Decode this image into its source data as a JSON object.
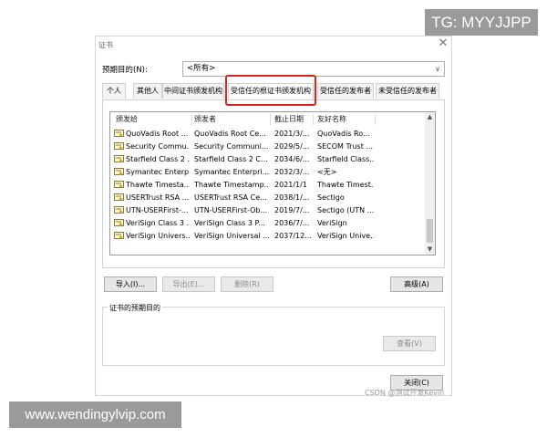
{
  "watermarks": {
    "top_right": "TG: MYYJJPP",
    "bottom_left": "www.wendingylvip.com",
    "csdn": "CSDN @测试开发Kevin"
  },
  "dialog": {
    "title": "证书",
    "close_glyph": "✕",
    "purpose_label": "预期目的(N):",
    "purpose_value": "<所有>",
    "tabs": [
      {
        "label": "个人"
      },
      {
        "label": "其他人"
      },
      {
        "label": "中间证书颁发机构"
      },
      {
        "label": "受信任的根证书颁发机构"
      },
      {
        "label": "受信任的发布者"
      },
      {
        "label": "未受信任的发布者"
      }
    ],
    "active_tab": 3,
    "columns": [
      "颁发给",
      "颁发者",
      "截止日期",
      "友好名称"
    ],
    "rows": [
      [
        "QuoVadis Root ...",
        "QuoVadis Root Ce...",
        "2021/3/...",
        "QuoVadis Ro..."
      ],
      [
        "Security Commu...",
        "Security Communi...",
        "2029/5/...",
        "SECOM Trust ..."
      ],
      [
        "Starfield Class 2 ...",
        "Starfield Class 2 C...",
        "2034/6/...",
        "Starfield Class..."
      ],
      [
        "Symantec Enterp...",
        "Symantec Enterpri...",
        "2032/3/...",
        "<无>"
      ],
      [
        "Thawte Timesta...",
        "Thawte Timestamp...",
        "2021/1/1",
        "Thawte Timest..."
      ],
      [
        "USERTrust RSA ...",
        "USERTrust RSA Ce...",
        "2038/1/...",
        "Sectigo"
      ],
      [
        "UTN-USERFirst-...",
        "UTN-USERFirst-Ob...",
        "2019/7/...",
        "Sectigo (UTN ..."
      ],
      [
        "VeriSign Class 3 ...",
        "VeriSign Class 3 P...",
        "2036/7/...",
        "VeriSign"
      ],
      [
        "VeriSign Univers...",
        "VeriSign Universal ...",
        "2037/12...",
        "VeriSign Unive..."
      ]
    ],
    "buttons": {
      "import": "导入(I)...",
      "export": "导出(E)...",
      "remove": "删除(R)",
      "advanced": "高级(A)",
      "view": "查看(V)",
      "close": "关闭(C)"
    },
    "group_label": "证书的预期目的"
  },
  "colors": {
    "highlight": "#d9261c",
    "watermark_bg": "#9a9a9a"
  },
  "icons": {
    "row_icon": "certificate-icon",
    "dropdown": "chevron-down-icon",
    "scroll_up": "scroll-up-icon",
    "scroll_down": "scroll-down-icon"
  }
}
